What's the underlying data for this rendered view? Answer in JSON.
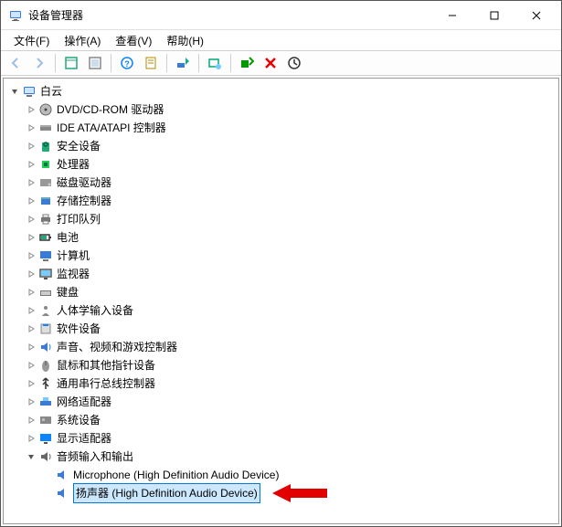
{
  "window": {
    "title": "设备管理器"
  },
  "menus": {
    "file": "文件(F)",
    "action": "操作(A)",
    "view": "查看(V)",
    "help": "帮助(H)"
  },
  "toolbar": {
    "back": "back",
    "forward": "forward",
    "show_hide": "show-hide",
    "set_scope": "set-scope",
    "help": "help",
    "properties": "properties",
    "update_driver": "update-driver",
    "scan": "scan",
    "add_legacy": "add-legacy",
    "disable": "disable",
    "uninstall": "uninstall"
  },
  "tree": {
    "root": {
      "label": "白云",
      "expanded": true,
      "icon": "computer-icon"
    },
    "categories": [
      {
        "label": "DVD/CD-ROM 驱动器",
        "icon": "dvd-icon",
        "expandable": true
      },
      {
        "label": "IDE ATA/ATAPI 控制器",
        "icon": "ide-icon",
        "expandable": true
      },
      {
        "label": "安全设备",
        "icon": "security-icon",
        "expandable": true
      },
      {
        "label": "处理器",
        "icon": "cpu-icon",
        "expandable": true
      },
      {
        "label": "磁盘驱动器",
        "icon": "disk-icon",
        "expandable": true
      },
      {
        "label": "存储控制器",
        "icon": "storage-icon",
        "expandable": true
      },
      {
        "label": "打印队列",
        "icon": "printer-icon",
        "expandable": true
      },
      {
        "label": "电池",
        "icon": "battery-icon",
        "expandable": true
      },
      {
        "label": "计算机",
        "icon": "pc-icon",
        "expandable": true
      },
      {
        "label": "监视器",
        "icon": "monitor-icon",
        "expandable": true
      },
      {
        "label": "键盘",
        "icon": "keyboard-icon",
        "expandable": true
      },
      {
        "label": "人体学输入设备",
        "icon": "hid-icon",
        "expandable": true
      },
      {
        "label": "软件设备",
        "icon": "software-icon",
        "expandable": true
      },
      {
        "label": "声音、视频和游戏控制器",
        "icon": "sound-icon",
        "expandable": true
      },
      {
        "label": "鼠标和其他指针设备",
        "icon": "mouse-icon",
        "expandable": true
      },
      {
        "label": "通用串行总线控制器",
        "icon": "usb-icon",
        "expandable": true
      },
      {
        "label": "网络适配器",
        "icon": "net-icon",
        "expandable": true
      },
      {
        "label": "系统设备",
        "icon": "system-icon",
        "expandable": true
      },
      {
        "label": "显示适配器",
        "icon": "display-icon",
        "expandable": true
      },
      {
        "label": "音频输入和输出",
        "icon": "audio-io-icon",
        "expandable": true,
        "expanded": true,
        "children": [
          {
            "label": "Microphone (High Definition Audio Device)",
            "icon": "audio-dev-icon"
          },
          {
            "label": "扬声器 (High Definition Audio Device)",
            "icon": "audio-dev-icon",
            "selected": true
          }
        ]
      }
    ]
  },
  "colors": {
    "selection_bg": "#cce8ff",
    "selection_border": "#0078d7",
    "callout_red": "#e20000"
  }
}
